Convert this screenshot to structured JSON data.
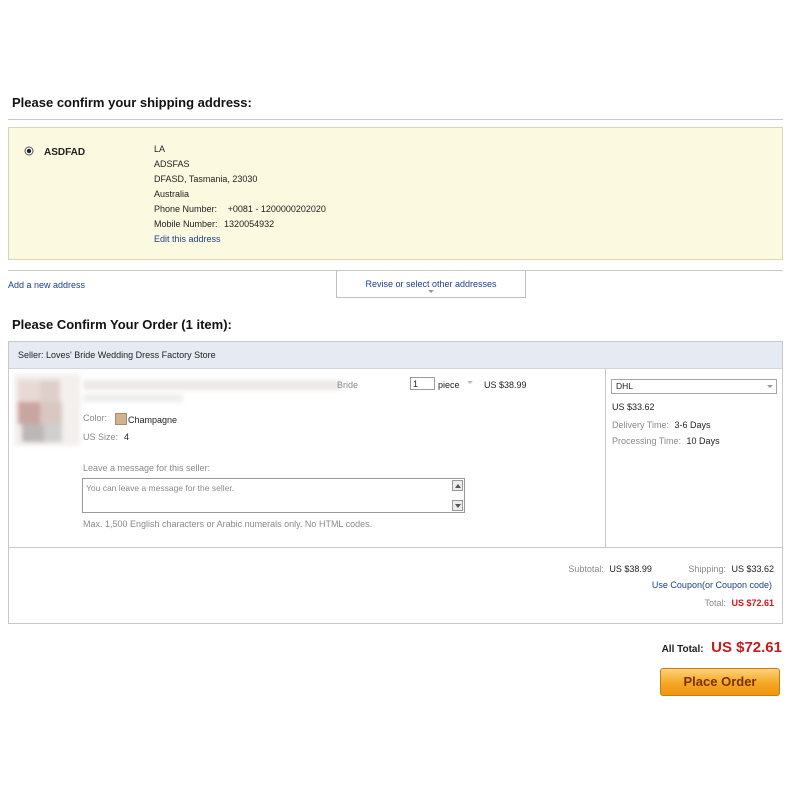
{
  "shipping": {
    "title": "Please confirm your shipping address:",
    "address": {
      "name": "ASDFAD",
      "lines": [
        "LA",
        "ADSFAS",
        "DFASD, Tasmania, 23030",
        "Australia"
      ],
      "phone_label": "Phone Number:",
      "phone_value": "+0081 - 1200000202020",
      "mobile_label": "Mobile Number:",
      "mobile_value": "1320054932",
      "edit_link": "Edit this address"
    },
    "add_link": "Add a new address",
    "revise_button": "Revise or select other addresses"
  },
  "order": {
    "title": "Please Confirm Your Order (1 item):",
    "seller": "Seller: Loves' Bride Wedding Dress Factory Store",
    "item": {
      "title_fragment": "Bride",
      "quantity": "1",
      "unit": "piece",
      "price": "US $38.99",
      "color_label": "Color:",
      "color_value": "Champagne",
      "size_label": "US Size:",
      "size_value": "4",
      "message_label": "Leave a message for this seller:",
      "message_placeholder": "You can leave a message for the seller.",
      "message_note": "Max. 1,500 English characters or Arabic numerals only. No HTML codes.",
      "swatch_color": "#d2b38f"
    },
    "shipping_method": {
      "selected": "DHL",
      "cost": "US $33.62",
      "delivery_label": "Delivery Time:",
      "delivery_value": "3-6 Days",
      "processing_label": "Processing Time:",
      "processing_value": "10 Days"
    },
    "summary": {
      "subtotal_label": "Subtotal:",
      "subtotal_value": "US $38.99",
      "shipping_label": "Shipping:",
      "shipping_value": "US $33.62",
      "coupon_link": "Use Coupon(or Coupon code)",
      "total_label": "Total:",
      "total_value": "US $72.61"
    }
  },
  "footer": {
    "all_total_label": "All Total:",
    "all_total_value": "US $72.61",
    "place_order": "Place Order"
  },
  "colors": {
    "address_bg": "#fbf9df",
    "seller_bar": "#e6ebf3",
    "accent_red": "#c81a1a",
    "link_blue": "#1b3f8c",
    "button_orange": "#f5a623"
  }
}
